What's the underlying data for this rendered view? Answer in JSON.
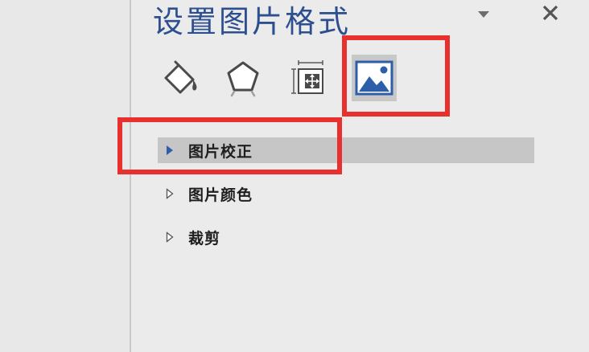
{
  "pane": {
    "title": "设置图片格式"
  },
  "tabs": [
    {
      "name": "fill-line",
      "icon": "paint-bucket-icon"
    },
    {
      "name": "effects",
      "icon": "pentagon-icon"
    },
    {
      "name": "size-properties",
      "icon": "size-position-icon"
    },
    {
      "name": "picture",
      "icon": "picture-icon",
      "active": true
    }
  ],
  "sections": [
    {
      "label": "图片校正",
      "expanded": false,
      "selected": true
    },
    {
      "label": "图片颜色",
      "expanded": false,
      "selected": false
    },
    {
      "label": "裁剪",
      "expanded": false,
      "selected": false
    }
  ],
  "colors": {
    "title": "#2d4f8f",
    "highlight_box": "#e8312e",
    "selected_row": "#c6c6c6",
    "accent_arrow": "#2e5eaa"
  }
}
